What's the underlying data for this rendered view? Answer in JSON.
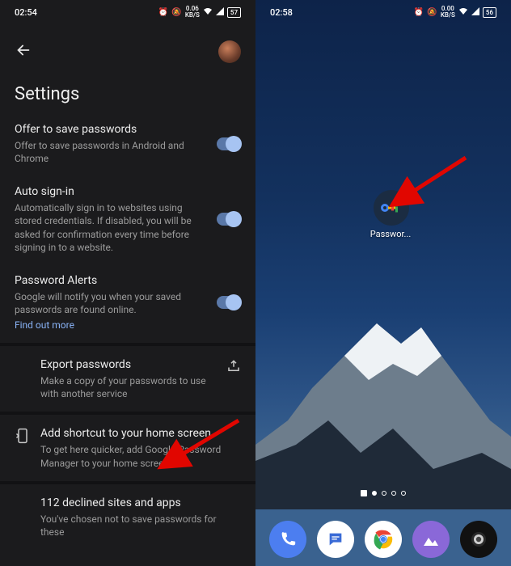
{
  "left": {
    "status": {
      "time": "02:54",
      "net": "0.06",
      "net_unit": "KB/S",
      "battery": "57"
    },
    "title": "Settings",
    "offer": {
      "title": "Offer to save passwords",
      "desc": "Offer to save passwords in Android and Chrome"
    },
    "auto": {
      "title": "Auto sign-in",
      "desc": "Automatically sign in to websites using stored credentials. If disabled, you will be asked for confirmation every time before signing in to a website."
    },
    "alerts": {
      "title": "Password Alerts",
      "desc": "Google will notify you when your saved passwords are found online.",
      "link": "Find out more"
    },
    "export": {
      "title": "Export passwords",
      "desc": "Make a copy of your passwords to use with another service"
    },
    "shortcut": {
      "title": "Add shortcut to your home screen",
      "desc": "To get here quicker, add Google Password Manager to your home screen"
    },
    "declined": {
      "title": "112 declined sites and apps",
      "desc": "You've chosen not to save passwords for these"
    }
  },
  "right": {
    "status": {
      "time": "02:58",
      "net": "0.00",
      "net_unit": "KB/S",
      "battery": "56"
    },
    "icon_label": "Passwor..."
  }
}
